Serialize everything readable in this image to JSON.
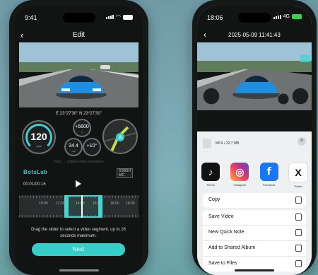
{
  "left_phone": {
    "status_time": "9:41",
    "title": "Edit",
    "coordinates": "E 23°27'30\" N 23°27'30\"",
    "speed": {
      "value": "120",
      "unit": "mph"
    },
    "small_gauges": [
      {
        "value": "+5600",
        "sub": "ft"
      },
      {
        "value": "34.4",
        "sub": "mph"
      },
      {
        "value": "+10°",
        "sub": "°"
      }
    ],
    "map_marker": "A",
    "note": "Fast → original video resolution",
    "brand": "BotsLab",
    "model_tag": "G980H MC",
    "timecode": "00:01/00:16",
    "timeline_ticks": [
      "10:00",
      "12:00",
      "14:00",
      "15:00",
      "16:00",
      "18:00"
    ],
    "hint": "Drag the slider to select a video segment, up to 16 seconds maximum.",
    "next_label": "Next"
  },
  "right_phone": {
    "status_time": "18:06",
    "network": "4G",
    "title": "2025-05-09 11:41:43",
    "file_info": "MP4 • 22.7 MB",
    "apps": [
      {
        "name": "TikTok",
        "icon": "tiktok-icon"
      },
      {
        "name": "Instagram",
        "icon": "instagram-icon"
      },
      {
        "name": "Facebook",
        "icon": "facebook-icon"
      },
      {
        "name": "Twitter",
        "icon": "x-icon"
      }
    ],
    "actions_group1": [
      {
        "label": "Copy",
        "icon": "copy-icon"
      }
    ],
    "actions_group2": [
      {
        "label": "Save Video",
        "icon": "save-icon"
      },
      {
        "label": "New Quick Note",
        "icon": "quick-note-icon"
      },
      {
        "label": "Add to Shared Album",
        "icon": "shared-album-icon"
      },
      {
        "label": "Save to Files",
        "icon": "folder-icon"
      }
    ]
  },
  "colors": {
    "accent": "#35cec9",
    "background": "#7aa6b2",
    "car": "#1f8ee0"
  }
}
